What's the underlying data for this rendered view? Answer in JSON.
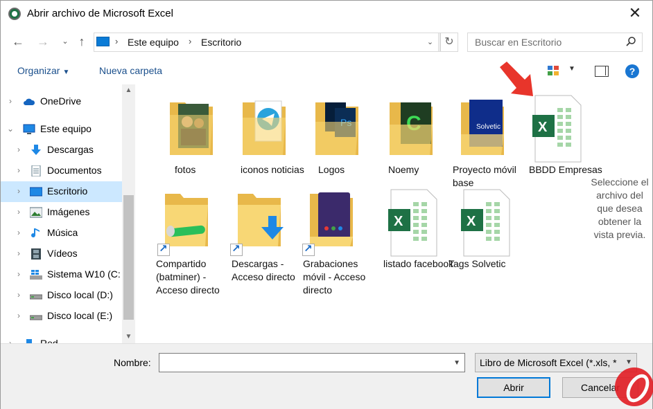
{
  "window": {
    "title": "Abrir archivo de Microsoft Excel"
  },
  "nav": {
    "breadcrumb": [
      "Este equipo",
      "Escritorio"
    ],
    "search_placeholder": "Buscar en Escritorio"
  },
  "toolbar": {
    "organize_label": "Organizar",
    "new_folder_label": "Nueva carpeta"
  },
  "sidebar": {
    "items": [
      {
        "label": "OneDrive",
        "icon": "cloud-icon"
      },
      {
        "label": "Este equipo",
        "icon": "computer-icon"
      },
      {
        "label": "Descargas",
        "icon": "download-arrow-icon"
      },
      {
        "label": "Documentos",
        "icon": "document-icon"
      },
      {
        "label": "Escritorio",
        "icon": "desktop-icon"
      },
      {
        "label": "Imágenes",
        "icon": "picture-icon"
      },
      {
        "label": "Música",
        "icon": "music-note-icon"
      },
      {
        "label": "Vídeos",
        "icon": "film-icon"
      },
      {
        "label": "Sistema W10 (C:",
        "icon": "system-drive-icon"
      },
      {
        "label": "Disco local (D:)",
        "icon": "drive-icon"
      },
      {
        "label": "Disco local (E:)",
        "icon": "drive-icon"
      },
      {
        "label": "Red",
        "icon": "network-icon"
      }
    ],
    "selected": "Escritorio"
  },
  "files": [
    {
      "label": "fotos",
      "type": "folder",
      "icon": "folder-photos-icon"
    },
    {
      "label": "iconos noticias",
      "type": "folder",
      "icon": "folder-telegram-icon"
    },
    {
      "label": "Logos",
      "type": "folder",
      "icon": "folder-photoshop-icon"
    },
    {
      "label": "Noemy",
      "type": "folder",
      "icon": "folder-camtasia-icon"
    },
    {
      "label": "Proyecto móvil base",
      "type": "folder",
      "icon": "folder-solvetic-icon"
    },
    {
      "label": "BBDD Empresas",
      "type": "excel",
      "icon": "excel-file-icon"
    },
    {
      "label": "Compartido (batminer) - Acceso directo",
      "type": "shortcut",
      "icon": "folder-shared-shortcut-icon"
    },
    {
      "label": "Descargas - Acceso directo",
      "type": "shortcut",
      "icon": "folder-downloads-shortcut-icon"
    },
    {
      "label": "Grabaciones móvil - Acceso directo",
      "type": "shortcut",
      "icon": "folder-recordings-shortcut-icon"
    },
    {
      "label": "listado facebook",
      "type": "excel",
      "icon": "excel-file-icon"
    },
    {
      "label": "Tags Solvetic",
      "type": "excel",
      "icon": "excel-file-icon"
    }
  ],
  "preview_message": "Seleccione el archivo del que desea obtener la vista previa.",
  "footer": {
    "name_label": "Nombre:",
    "name_value": "",
    "file_type": "Libro de Microsoft Excel (*.xls, *",
    "open_label": "Abrir",
    "cancel_label": "Cancelar"
  },
  "colors": {
    "accent": "#0078d7",
    "excel_green": "#1e7145",
    "selection": "#cce8ff",
    "folder": "#f8d775",
    "arrow_red": "#e8352b"
  }
}
